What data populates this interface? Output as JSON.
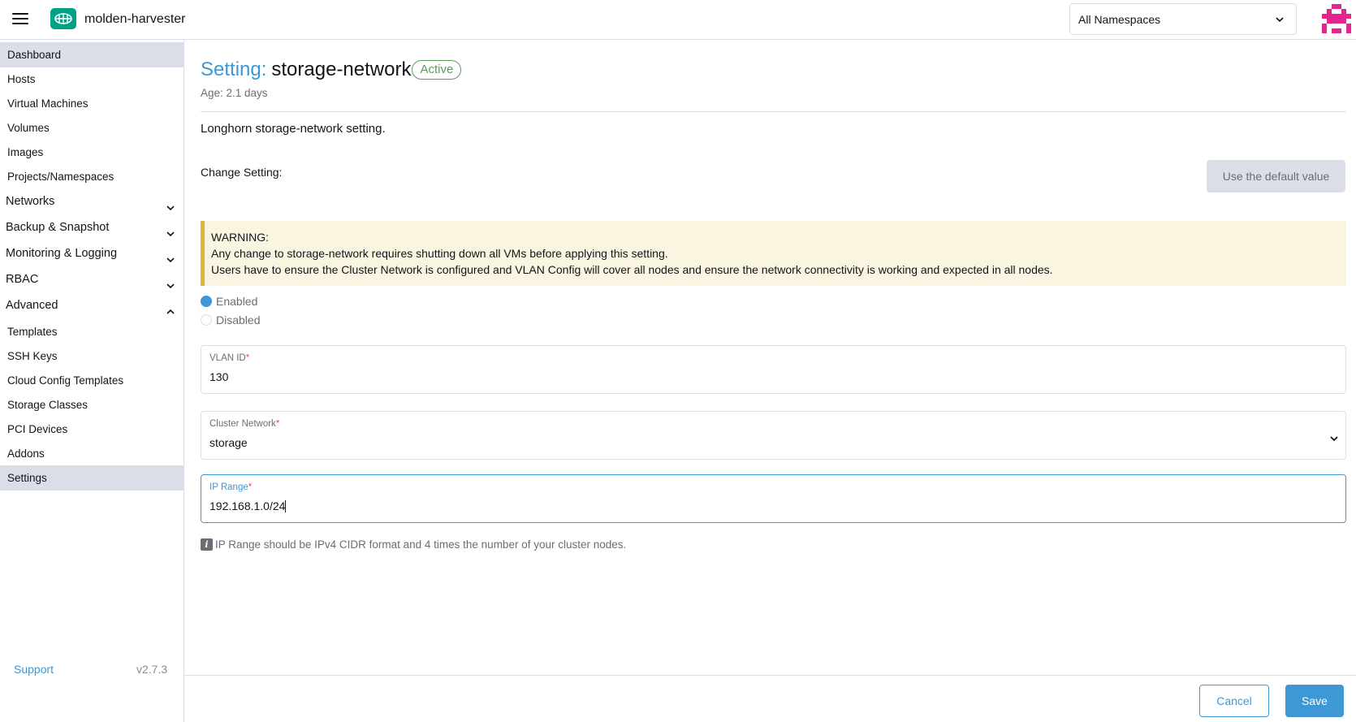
{
  "header": {
    "cluster_name": "molden-harvester",
    "namespace_selected": "All Namespaces",
    "menu_icon": "hamburger-icon",
    "logo_icon": "harvester-logo-icon",
    "avatar_icon": "user-avatar-icon"
  },
  "sidebar": {
    "items": [
      {
        "label": "Dashboard"
      },
      {
        "label": "Hosts"
      },
      {
        "label": "Virtual Machines"
      },
      {
        "label": "Volumes"
      },
      {
        "label": "Images"
      },
      {
        "label": "Projects/Namespaces"
      }
    ],
    "groups": [
      {
        "label": "Networks",
        "expanded": false
      },
      {
        "label": "Backup & Snapshot",
        "expanded": false
      },
      {
        "label": "Monitoring & Logging",
        "expanded": false
      },
      {
        "label": "RBAC",
        "expanded": false
      },
      {
        "label": "Advanced",
        "expanded": true
      }
    ],
    "advanced_items": [
      {
        "label": "Templates"
      },
      {
        "label": "SSH Keys"
      },
      {
        "label": "Cloud Config Templates"
      },
      {
        "label": "Storage Classes"
      },
      {
        "label": "PCI Devices"
      },
      {
        "label": "Addons"
      },
      {
        "label": "Settings"
      }
    ],
    "support": "Support",
    "version": "v2.7.3"
  },
  "main": {
    "title_prefix": "Setting:",
    "title_name": "storage-network",
    "status": "Active",
    "age": "Age: 2.1 days",
    "description": "Longhorn storage-network setting.",
    "change_setting_label": "Change Setting:",
    "default_button": "Use the default value",
    "warning": {
      "heading": "WARNING:",
      "line1": "Any change to storage-network requires shutting down all VMs before applying this setting.",
      "line2": "Users have to ensure the Cluster Network is configured and VLAN Config will cover all nodes and ensure the network connectivity is working and expected in all nodes."
    },
    "radio_enabled": "Enabled",
    "radio_disabled": "Disabled",
    "vlan": {
      "label": "VLAN ID",
      "required_mark": "*",
      "value": "130"
    },
    "cluster_network": {
      "label": "Cluster Network",
      "required_mark": "*",
      "value": "storage"
    },
    "ip_range": {
      "label": "IP Range",
      "required_mark": "*",
      "value": "192.168.1.0/24"
    },
    "hint": "IP Range should be IPv4 CIDR format and 4 times the number of your cluster nodes.",
    "hint_icon": "info-icon"
  },
  "footer": {
    "cancel": "Cancel",
    "save": "Save"
  },
  "colors": {
    "accent": "#3d98d3",
    "active_badge": "#5d995d",
    "warning_bg": "#f9f5e1",
    "warning_border": "#e0b731",
    "logo": "#00a286",
    "avatar": "#e3268f"
  }
}
